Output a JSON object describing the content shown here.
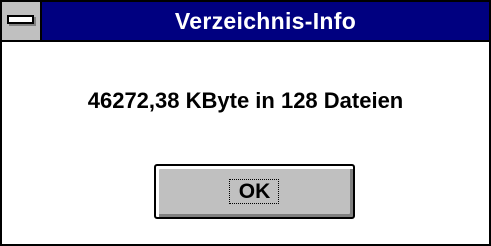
{
  "window": {
    "title": "Verzeichnis-Info",
    "system_menu_icon": "system-menu-icon"
  },
  "dialog": {
    "message": "46272,38 KByte in 128 Dateien",
    "ok_label": "OK"
  },
  "colors": {
    "titlebar": "#000080",
    "title_text": "#ffffff",
    "button_face": "#c0c0c0",
    "background": "#ffffff",
    "border": "#000000"
  }
}
